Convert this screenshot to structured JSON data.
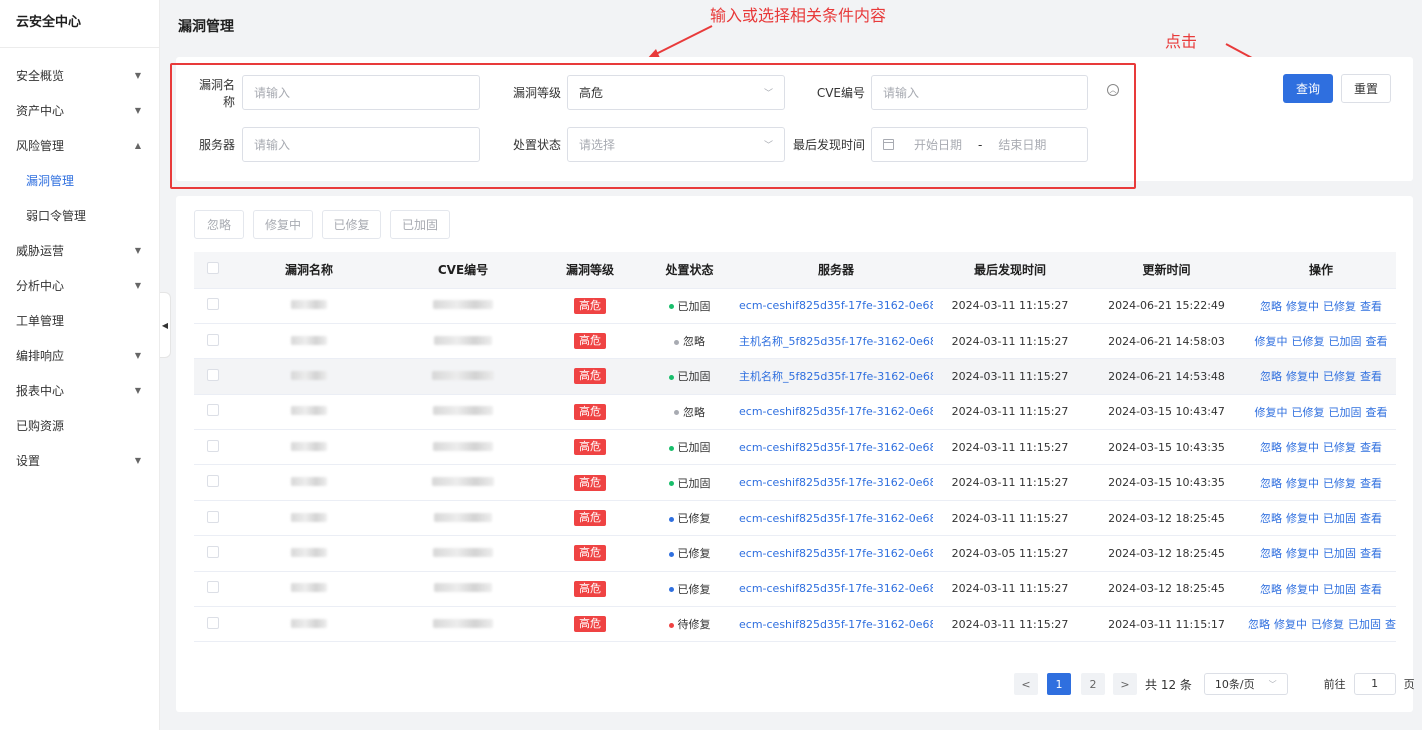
{
  "sidebar": {
    "brand": "云安全中心",
    "items": [
      {
        "label": "安全概览",
        "expandable": true,
        "expanded": false
      },
      {
        "label": "资产中心",
        "expandable": true,
        "expanded": false
      },
      {
        "label": "风险管理",
        "expandable": true,
        "expanded": true
      },
      {
        "label": "漏洞管理",
        "sub": true,
        "active": true
      },
      {
        "label": "弱口令管理",
        "sub": true
      },
      {
        "label": "威胁运营",
        "expandable": true,
        "expanded": false
      },
      {
        "label": "分析中心",
        "expandable": true,
        "expanded": false
      },
      {
        "label": "工单管理",
        "expandable": false
      },
      {
        "label": "编排响应",
        "expandable": true,
        "expanded": false
      },
      {
        "label": "报表中心",
        "expandable": true,
        "expanded": false
      },
      {
        "label": "已购资源",
        "expandable": false
      },
      {
        "label": "设置",
        "expandable": true,
        "expanded": false
      }
    ]
  },
  "page": {
    "title": "漏洞管理"
  },
  "annotations": {
    "input_hint": "输入或选择相关条件内容",
    "click_hint": "点击",
    "color": "#e83a3a"
  },
  "filters": {
    "vuln_name": {
      "label": "漏洞名称",
      "placeholder": "请输入"
    },
    "vuln_level": {
      "label": "漏洞等级",
      "value": "高危"
    },
    "cve": {
      "label": "CVE编号",
      "placeholder": "请输入"
    },
    "server": {
      "label": "服务器",
      "placeholder": "请输入"
    },
    "status": {
      "label": "处置状态",
      "placeholder": "请选择"
    },
    "last_found": {
      "label": "最后发现时间",
      "start_placeholder": "开始日期",
      "separator": "-",
      "end_placeholder": "结束日期"
    }
  },
  "actions": {
    "query": "查询",
    "reset": "重置"
  },
  "bulk": [
    "忽略",
    "修复中",
    "已修复",
    "已加固"
  ],
  "table": {
    "columns": [
      "漏洞名称",
      "CVE编号",
      "漏洞等级",
      "处置状态",
      "服务器",
      "最后发现时间",
      "更新时间",
      "操作"
    ],
    "rows": [
      {
        "level": "高危",
        "status": "已加固",
        "status_color": "#19be6b",
        "server": "ecm-ceshif825d35f-17fe-3162-0e68-...",
        "found": "2024-03-11 11:15:27",
        "updated": "2024-06-21 15:22:49",
        "ops": [
          "忽略",
          "修复中",
          "已修复",
          "查看"
        ]
      },
      {
        "level": "高危",
        "status": "忽略",
        "status_color": "#a8abb2",
        "server": "主机名称_5f825d35f-17fe-3162-0e68...",
        "found": "2024-03-11 11:15:27",
        "updated": "2024-06-21 14:58:03",
        "ops": [
          "修复中",
          "已修复",
          "已加固",
          "查看"
        ]
      },
      {
        "level": "高危",
        "status": "已加固",
        "status_color": "#19be6b",
        "server": "主机名称_5f825d35f-17fe-3162-0e68...",
        "found": "2024-03-11 11:15:27",
        "updated": "2024-06-21 14:53:48",
        "ops": [
          "忽略",
          "修复中",
          "已修复",
          "查看"
        ]
      },
      {
        "level": "高危",
        "status": "忽略",
        "status_color": "#a8abb2",
        "server": "ecm-ceshif825d35f-17fe-3162-0e68-...",
        "found": "2024-03-11 11:15:27",
        "updated": "2024-03-15 10:43:47",
        "ops": [
          "修复中",
          "已修复",
          "已加固",
          "查看"
        ]
      },
      {
        "level": "高危",
        "status": "已加固",
        "status_color": "#19be6b",
        "server": "ecm-ceshif825d35f-17fe-3162-0e68-...",
        "found": "2024-03-11 11:15:27",
        "updated": "2024-03-15 10:43:35",
        "ops": [
          "忽略",
          "修复中",
          "已修复",
          "查看"
        ]
      },
      {
        "level": "高危",
        "status": "已加固",
        "status_color": "#19be6b",
        "server": "ecm-ceshif825d35f-17fe-3162-0e68-...",
        "found": "2024-03-11 11:15:27",
        "updated": "2024-03-15 10:43:35",
        "ops": [
          "忽略",
          "修复中",
          "已修复",
          "查看"
        ]
      },
      {
        "level": "高危",
        "status": "已修复",
        "status_color": "#2f6fdf",
        "server": "ecm-ceshif825d35f-17fe-3162-0e68-...",
        "found": "2024-03-11 11:15:27",
        "updated": "2024-03-12 18:25:45",
        "ops": [
          "忽略",
          "修复中",
          "已加固",
          "查看"
        ]
      },
      {
        "level": "高危",
        "status": "已修复",
        "status_color": "#2f6fdf",
        "server": "ecm-ceshif825d35f-17fe-3162-0e68-...",
        "found": "2024-03-05 11:15:27",
        "updated": "2024-03-12 18:25:45",
        "ops": [
          "忽略",
          "修复中",
          "已加固",
          "查看"
        ]
      },
      {
        "level": "高危",
        "status": "已修复",
        "status_color": "#2f6fdf",
        "server": "ecm-ceshif825d35f-17fe-3162-0e68-...",
        "found": "2024-03-11 11:15:27",
        "updated": "2024-03-12 18:25:45",
        "ops": [
          "忽略",
          "修复中",
          "已加固",
          "查看"
        ]
      },
      {
        "level": "高危",
        "status": "待修复",
        "status_color": "#ef4343",
        "server": "ecm-ceshif825d35f-17fe-3162-0e68-...",
        "found": "2024-03-11 11:15:27",
        "updated": "2024-03-11 11:15:17",
        "ops": [
          "忽略",
          "修复中",
          "已修复",
          "已加固",
          "查看"
        ]
      }
    ]
  },
  "pagination": {
    "prev": "<",
    "next": ">",
    "pages": [
      "1",
      "2"
    ],
    "current": "1",
    "total": "共 12 条",
    "page_size": "10条/页",
    "goto_label": "前往",
    "goto_value": "1",
    "goto_suffix": "页"
  },
  "colors": {
    "primary": "#2f6fdf",
    "danger": "#ef4343",
    "success": "#19be6b"
  }
}
